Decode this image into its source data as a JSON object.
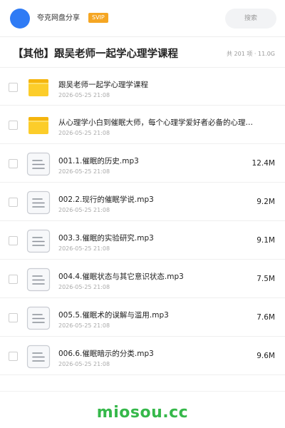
{
  "header": {
    "user_name": "夸克网盘分享",
    "badge": "SVIP",
    "search_placeholder": "搜索",
    "avatar_color": "#2f7bf5",
    "badge_color": "#f5a623"
  },
  "folder": {
    "title": "【其他】跟吴老师一起学心理学课程",
    "meta": "共 201 项 · 11.0G"
  },
  "items": [
    {
      "type": "folder",
      "icon": "folder-icon",
      "name": "跟吴老师一起学心理学课程",
      "date": "2026-05-25 21:08",
      "size": ""
    },
    {
      "type": "folder",
      "icon": "folder-icon",
      "name": "从心理学小白到催眠大师，每个心理学爱好者必备的心理…",
      "date": "2026-05-25 21:08",
      "size": ""
    },
    {
      "type": "file",
      "icon": "document-icon",
      "name": "001.1.催眠的历史.mp3",
      "date": "2026-05-25 21:08",
      "size": "12.4M"
    },
    {
      "type": "file",
      "icon": "document-icon",
      "name": "002.2.现行的催眠学说.mp3",
      "date": "2026-05-25 21:08",
      "size": "9.2M"
    },
    {
      "type": "file",
      "icon": "document-icon",
      "name": "003.3.催眠的实验研究.mp3",
      "date": "2026-05-25 21:08",
      "size": "9.1M"
    },
    {
      "type": "file",
      "icon": "document-icon",
      "name": "004.4.催眠状态与其它意识状态.mp3",
      "date": "2026-05-25 21:08",
      "size": "7.5M"
    },
    {
      "type": "file",
      "icon": "document-icon",
      "name": "005.5.催眠术的误解与滥用.mp3",
      "date": "2026-05-25 21:08",
      "size": "7.6M"
    },
    {
      "type": "file",
      "icon": "document-icon",
      "name": "006.6.催眠暗示的分类.mp3",
      "date": "2026-05-25 21:08",
      "size": "9.6M"
    }
  ],
  "footer": {
    "brand": "miosou.cc",
    "brand_color": "#35b84a"
  }
}
